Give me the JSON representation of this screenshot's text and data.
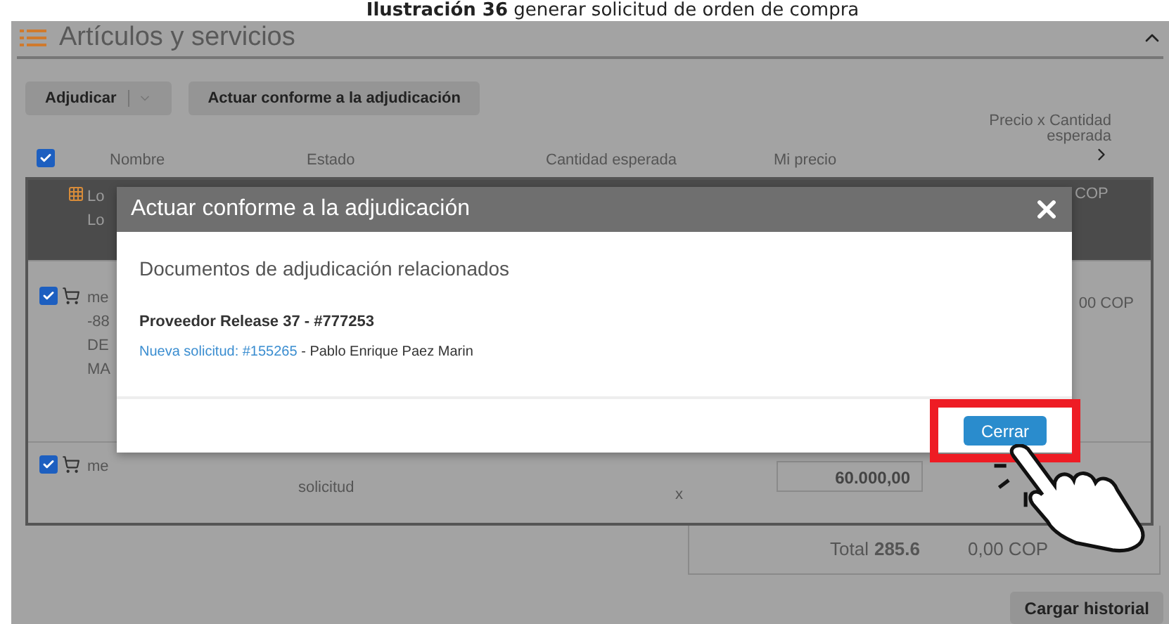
{
  "caption": "**Ilustración 36** generar solicitud de orden de compra",
  "panel": {
    "title": "Artículos y servicios",
    "expanded": true
  },
  "toolbar": {
    "award_button": "Adjudicar",
    "act_button": "Actuar conforme a la adjudicación"
  },
  "table": {
    "all_checked": true,
    "columns": [
      "Nombre",
      "Estado",
      "Cantidad esperada",
      "Mi precio",
      "Precio x Cantidad esperada"
    ],
    "rows": [
      {
        "kind": "lot",
        "name_lines": [
          "Lo",
          "Lo"
        ],
        "total": "COP"
      },
      {
        "kind": "item",
        "checked": true,
        "name_lines": [
          "me",
          "-88",
          "DE",
          "MA"
        ],
        "total": "00 COP"
      },
      {
        "kind": "item",
        "checked": true,
        "name_lines": [
          "me"
        ],
        "status": "solicitud",
        "quantity": "x",
        "price": "60.000,00"
      }
    ]
  },
  "total": {
    "label": "Total",
    "amount": "285.6",
    "tail": "0,00 COP"
  },
  "history_button": "Cargar historial",
  "dialog": {
    "title": "Actuar conforme a la adjudicación",
    "heading": "Documentos de adjudicación relacionados",
    "supplier": "Proveedor Release 37 - #777253",
    "link": "Nueva solicitud: #155265",
    "requester": " - Pablo Enrique Paez Marin",
    "close_button": "Cerrar",
    "highlighted": true
  }
}
